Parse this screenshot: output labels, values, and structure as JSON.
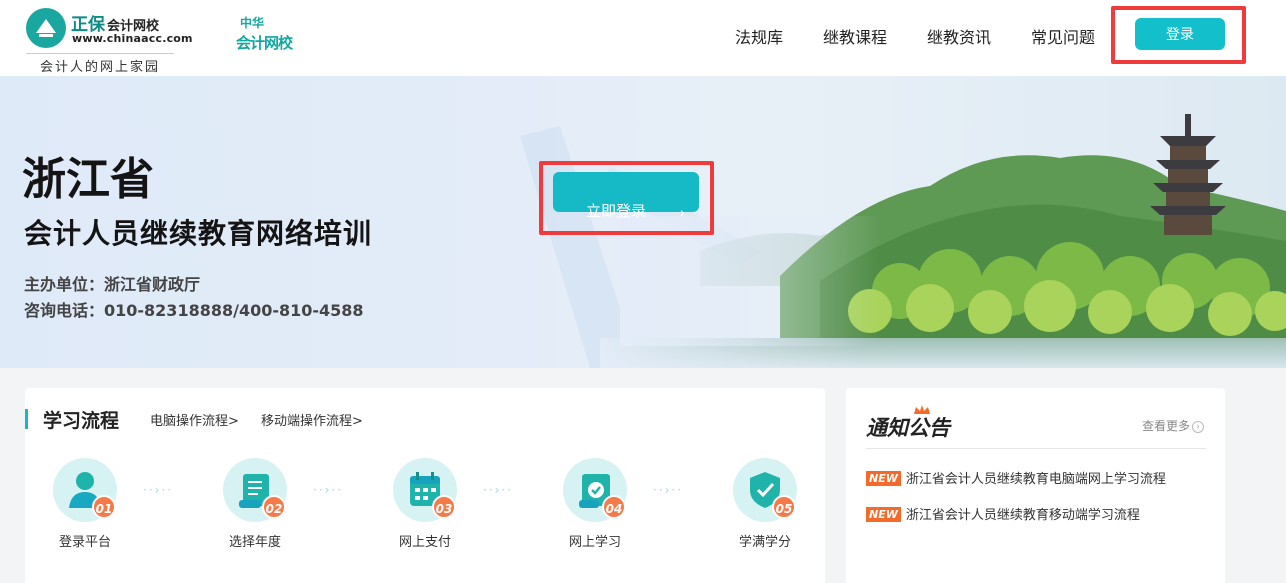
{
  "header": {
    "logo_title": "正保",
    "logo_title_sub": "会计网校",
    "logo_url": "www.chinaacc.com",
    "logo_slogan": "会计人的网上家园",
    "logo2_line1": "中华",
    "logo2_line2": "会计网校",
    "nav": [
      "法规库",
      "继教课程",
      "继教资讯",
      "常见问题"
    ],
    "login_label": "登录"
  },
  "banner": {
    "title": "浙江省",
    "subtitle": "会计人员继续教育网络培训",
    "organizer": "主办单位：浙江省财政厅",
    "hotline": "咨询电话：010-82318888/400-810-4588",
    "cta_label": "立即登录",
    "cta_chevron": "›"
  },
  "process": {
    "title": "学习流程",
    "links": [
      "电脑操作流程>",
      "移动端操作流程>"
    ],
    "steps": [
      {
        "num": "01",
        "label": "登录平台",
        "icon": "user-icon"
      },
      {
        "num": "02",
        "label": "选择年度",
        "icon": "scroll-icon"
      },
      {
        "num": "03",
        "label": "网上支付",
        "icon": "calendar-icon"
      },
      {
        "num": "04",
        "label": "网上学习",
        "icon": "certificate-icon"
      },
      {
        "num": "05",
        "label": "学满学分",
        "icon": "shield-check-icon"
      }
    ],
    "connector": "··›··"
  },
  "notice": {
    "title": "通知公告",
    "more_label": "查看更多",
    "more_icon": "›",
    "badge": "NEW",
    "items": [
      "浙江省会计人员继续教育电脑端网上学习流程",
      "浙江省会计人员继续教育移动端学习流程"
    ]
  },
  "colors": {
    "accent": "#13bfcb",
    "badge": "#f47a4a",
    "highlight": "#ef3b3b"
  }
}
